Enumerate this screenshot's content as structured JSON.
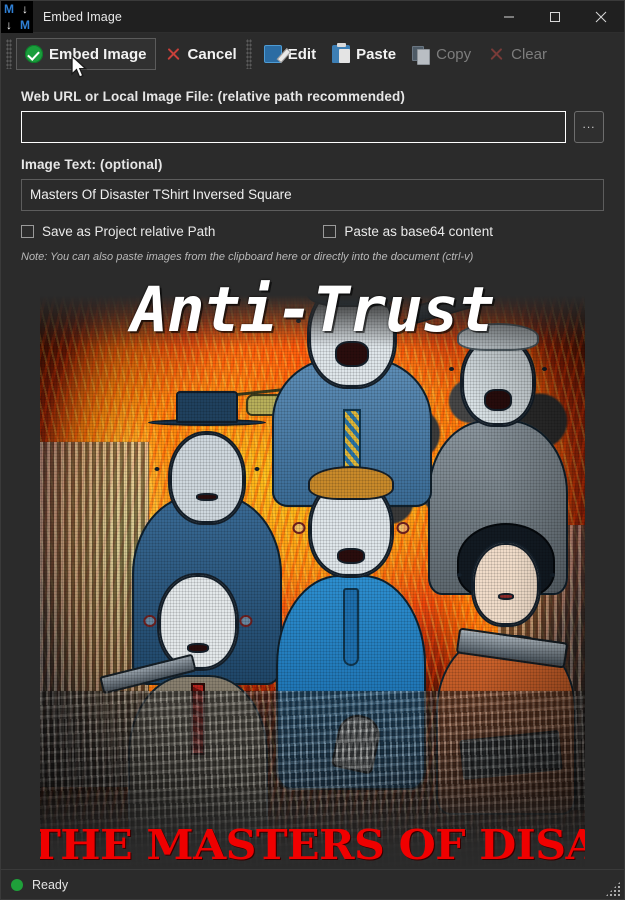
{
  "window": {
    "title": "Embed Image",
    "logo_chars": [
      "M",
      "↓",
      "↓",
      "M"
    ],
    "controls": {
      "minimize": "minimize-icon",
      "maximize": "maximize-icon",
      "close": "close-icon"
    }
  },
  "toolbar": {
    "items": [
      {
        "label": "Embed Image",
        "icon": "green-check-icon",
        "state": "focused"
      },
      {
        "label": "Cancel",
        "icon": "red-x-icon",
        "state": "enabled"
      },
      {
        "label": "Edit",
        "icon": "pencil-edit-icon",
        "state": "enabled"
      },
      {
        "label": "Paste",
        "icon": "clipboard-paste-icon",
        "state": "enabled"
      },
      {
        "label": "Copy",
        "icon": "copy-pages-icon",
        "state": "disabled"
      },
      {
        "label": "Clear",
        "icon": "red-x-icon",
        "state": "disabled"
      }
    ]
  },
  "form": {
    "url_label": "Web URL or Local Image File: (relative path recommended)",
    "url_value": "",
    "url_placeholder": "",
    "browse_label": "...",
    "text_label": "Image Text: (optional)",
    "text_value": "Masters Of Disaster TShirt Inversed Square",
    "text_placeholder": "",
    "checkbox_relative_path": {
      "label": "Save as Project relative Path",
      "checked": false
    },
    "checkbox_base64": {
      "label": "Paste as base64 content",
      "checked": false
    },
    "note": "Note: You can also paste images from the clipboard here or directly into the document (ctrl-v)"
  },
  "preview": {
    "title_text": "Anti-Trust",
    "bottom_text": "THE MASTERS OF DISASTER",
    "title_color": "#ffffff",
    "bottom_color": "#f00000"
  },
  "status": {
    "indicator_color": "#1fa03a",
    "text": "Ready"
  }
}
